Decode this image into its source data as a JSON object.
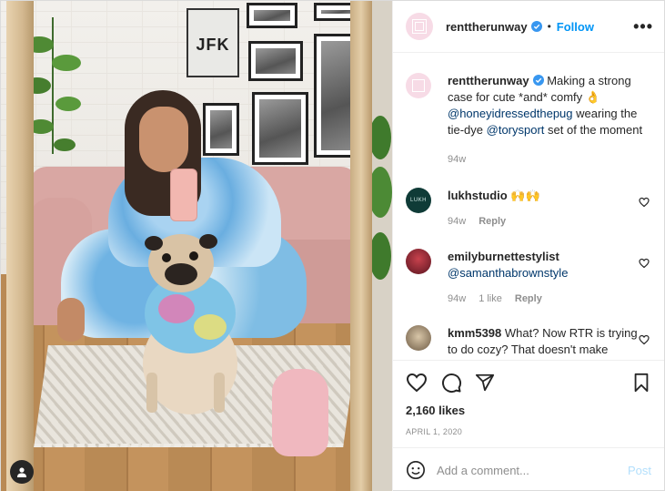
{
  "post": {
    "username": "renttherunway",
    "follow_label": "Follow",
    "separator": "•",
    "more_label": "•••",
    "likes": "2,160 likes",
    "date": "APRIL 1, 2020",
    "add_comment_placeholder": "Add a comment...",
    "post_label": "Post"
  },
  "caption": {
    "username": "renttherunway",
    "text_before": " Making a strong case for cute *and* comfy 👌 ",
    "mention1": "@honeyidressedthepug",
    "text_middle": " wearing the tie-dye ",
    "mention2": "@torysport",
    "text_after": " set of the moment",
    "time": "94w"
  },
  "comments": [
    {
      "username": "lukhstudio",
      "text": " 🙌🙌",
      "time": "94w",
      "likes": "",
      "reply": "Reply",
      "avatar_label": "LUKH"
    },
    {
      "username": "emilyburnettestylist",
      "mention": "@samanthabrownstyle",
      "time": "94w",
      "likes": "1 like",
      "reply": "Reply"
    },
    {
      "username": "kmm5398",
      "text": " What? Now RTR is trying to do cozy? That doesn't make sense. Careful with this company,",
      "time": "",
      "likes": "",
      "reply": ""
    }
  ],
  "photo": {
    "jfk_text": "JFK"
  },
  "colors": {
    "accent": "#0095f6",
    "text": "#262626",
    "muted": "#8e8e8e",
    "mention": "#00376b",
    "post_disabled": "#b2dffc",
    "brand_avatar": "#f7dbe6"
  },
  "icons": [
    "heart-icon",
    "comment-icon",
    "share-icon",
    "bookmark-icon",
    "emoji-icon",
    "verified-icon",
    "user-tag-icon",
    "more-icon"
  ]
}
